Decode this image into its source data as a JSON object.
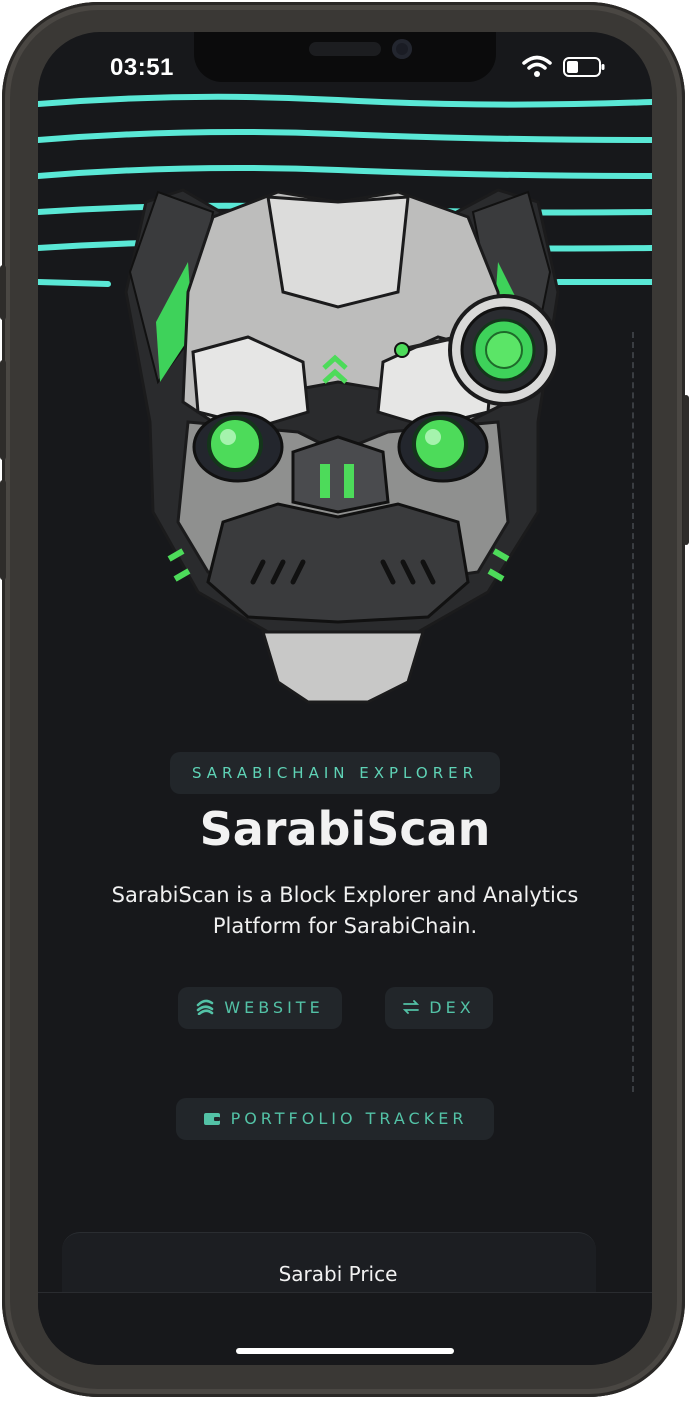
{
  "status_bar": {
    "time": "03:51",
    "wifi_icon": "wifi-icon",
    "battery_icon": "battery-icon"
  },
  "hero": {
    "image": "robot-bulldog-head-illustration",
    "accent": "#5ae8d6",
    "eye_color": "#4ddb5a"
  },
  "badge": "SARABICHAIN EXPLORER",
  "title": "SarabiScan",
  "description": "SarabiScan is a Block Explorer and Analytics Platform for SarabiChain.",
  "links": {
    "website": {
      "label": "WEBSITE",
      "icon": "website-logo-icon"
    },
    "dex": {
      "label": "DEX",
      "icon": "swap-arrows-icon"
    },
    "portfolio": {
      "label": "PORTFOLIO TRACKER",
      "icon": "wallet-icon"
    }
  },
  "price_card": {
    "title": "Sarabi Price"
  },
  "colors": {
    "background": "#17181b",
    "accent": "#53c2a6",
    "button_bg": "#22262a"
  }
}
